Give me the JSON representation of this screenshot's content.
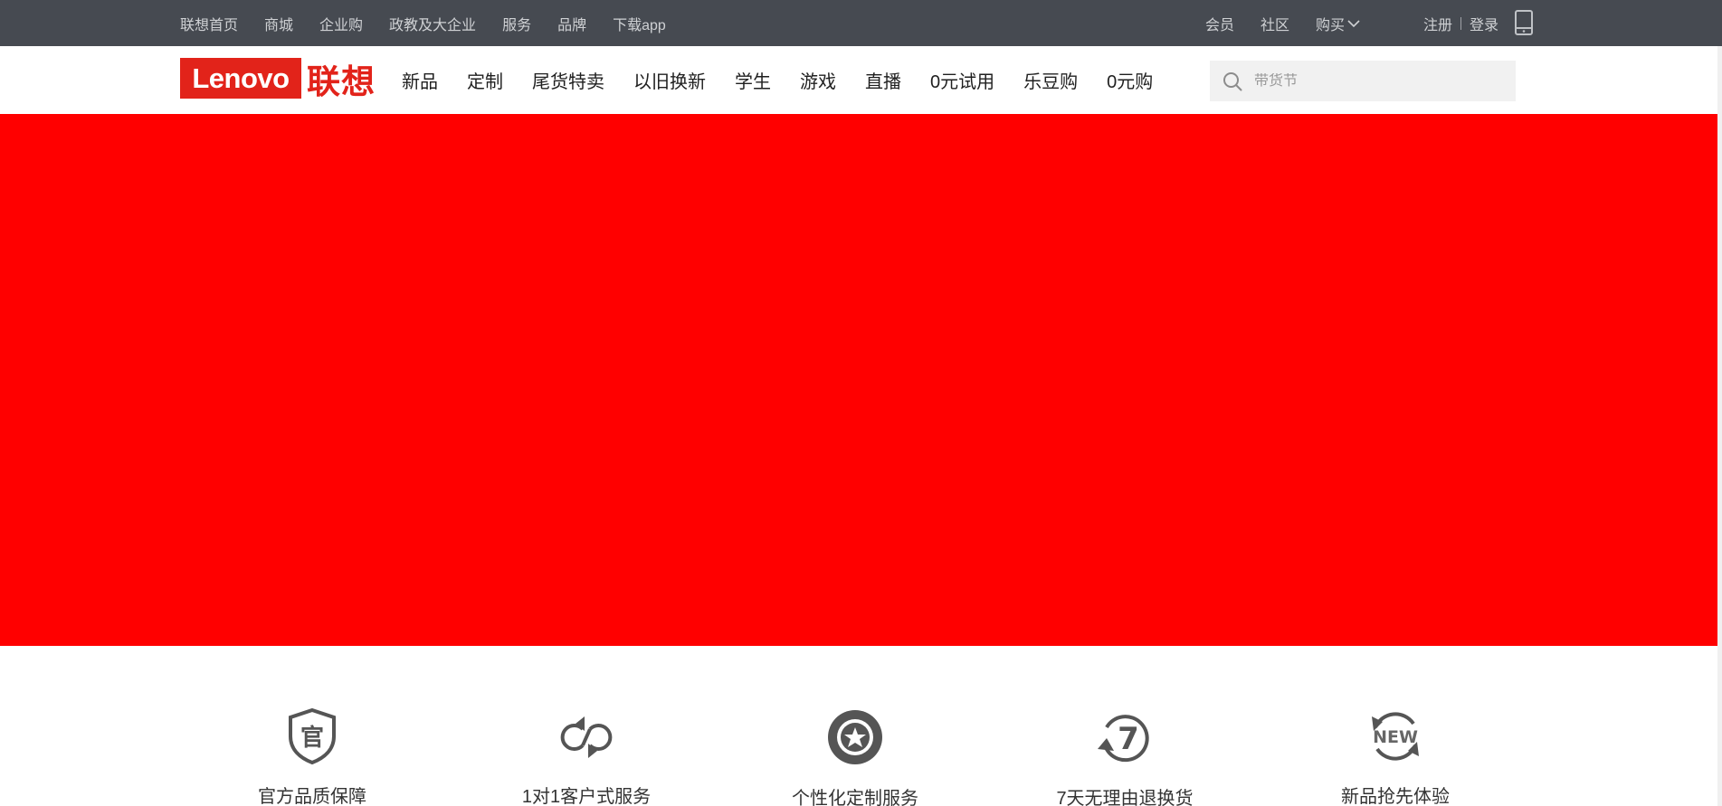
{
  "topbar": {
    "left_links": [
      "联想首页",
      "商城",
      "企业购",
      "政教及大企业",
      "服务",
      "品牌",
      "下载app"
    ],
    "right_links": [
      "会员",
      "社区"
    ],
    "buy_label": "购买",
    "register_label": "注册",
    "login_label": "登录",
    "phone_icon": "mobile-phone-icon"
  },
  "header": {
    "logo_en": "Lenovo",
    "logo_cn": "联想",
    "nav_items": [
      "新品",
      "定制",
      "尾货特卖",
      "以旧换新",
      "学生",
      "游戏",
      "直播",
      "0元试用",
      "乐豆购",
      "0元购"
    ],
    "search": {
      "placeholder": "带货节",
      "value": "",
      "icon": "search-icon"
    }
  },
  "banner": {
    "color": "#ff0000"
  },
  "features": [
    {
      "label": "官方品质保障",
      "icon": "official-shield-icon",
      "glyph": "官"
    },
    {
      "label": "1对1客户式服务",
      "icon": "service-loop-icon"
    },
    {
      "label": "个性化定制服务",
      "icon": "star-badge-icon"
    },
    {
      "label": "7天无理由退换货",
      "icon": "seven-day-return-icon",
      "glyph": "7"
    },
    {
      "label": "新品抢先体验",
      "icon": "new-product-icon",
      "glyph": "NEW"
    }
  ],
  "colors": {
    "topbar_bg": "#464a51",
    "brand_red": "#e2231a",
    "banner_red": "#ff0000",
    "search_bg": "#f1f1f1",
    "icon_gray": "#555555"
  }
}
